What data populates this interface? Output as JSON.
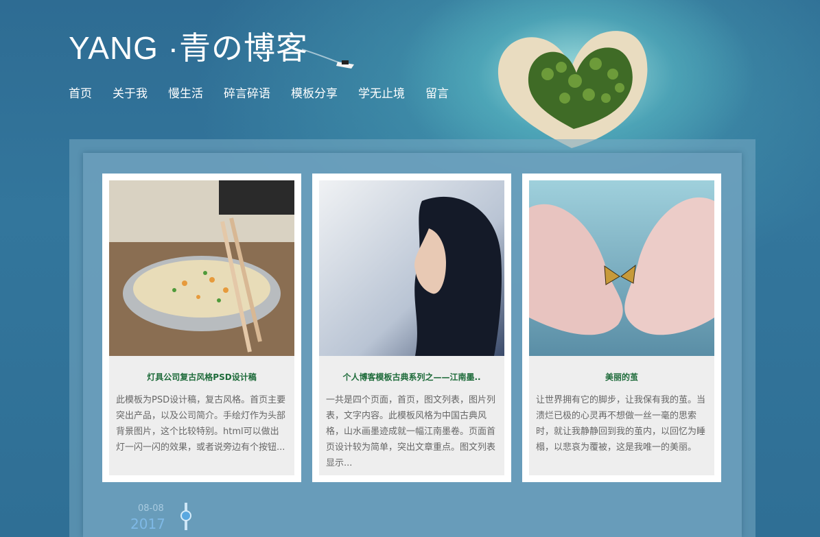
{
  "header": {
    "site_title": "YANG ·青の博客",
    "nav": [
      "首页",
      "关于我",
      "慢生活",
      "碎言碎语",
      "模板分享",
      "学无止境",
      "留言"
    ]
  },
  "cards": [
    {
      "title": "灯具公司复古风格PSD设计稿",
      "description": "此模板为PSD设计稿，复古风格。首页主要突出产品，以及公司简介。手绘灯作为头部背景图片，这个比较特别。html可以做出灯一闪一闪的效果，或者说旁边有个按钮..."
    },
    {
      "title": "个人博客模板古典系列之——江南墨..",
      "description": "一共是四个页面，首页，图文列表，图片列表，文字内容。此模板风格为中国古典风格，山水画墨迹成就一幅江南墨卷。页面首页设计较为简单，突出文章重点。图文列表显示..."
    },
    {
      "title": "美丽的茧",
      "description": "让世界拥有它的脚步，让我保有我的茧。当溃烂已极的心灵再不想做一丝一毫的思索时，就让我静静回到我的茧内，以回忆为睡榻，以悲哀为覆被，这是我唯一的美丽。"
    }
  ],
  "timeline": {
    "date": "08-08",
    "year": "2017"
  }
}
